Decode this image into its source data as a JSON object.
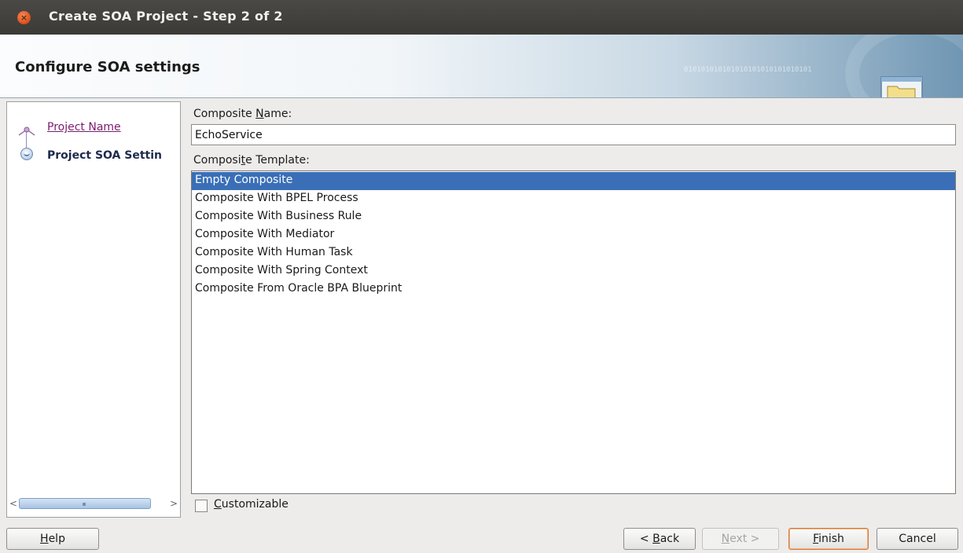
{
  "window": {
    "title": "Create SOA Project - Step 2 of 2",
    "close_glyph": "×"
  },
  "header": {
    "title": "Configure SOA settings",
    "decor_binary": "010101010101010101010101010101",
    "icon": "folder-window-icon"
  },
  "nav": {
    "items": [
      {
        "label": "Project Name",
        "state": "visited"
      },
      {
        "label": "Project SOA Settin",
        "state": "current"
      }
    ],
    "scroll_left": "<",
    "scroll_right": ">"
  },
  "form": {
    "composite_name": {
      "label_before": "Composite ",
      "label_mnemonic": "N",
      "label_after": "ame:",
      "value": "EchoService"
    },
    "composite_template": {
      "label_before": "Composi",
      "label_mnemonic": "t",
      "label_after": "e Template:",
      "selected_index": 0,
      "options": [
        "Empty Composite",
        "Composite With BPEL Process",
        "Composite With Business Rule",
        "Composite With Mediator",
        "Composite With Human Task",
        "Composite With Spring Context",
        "Composite From Oracle BPA Blueprint"
      ]
    },
    "customizable": {
      "label_mnemonic": "C",
      "label_rest": "ustomizable",
      "checked": false
    }
  },
  "buttons": {
    "help": {
      "mnemonic": "H",
      "rest": "elp"
    },
    "back": {
      "prefix": "< ",
      "mnemonic": "B",
      "rest": "ack"
    },
    "next": {
      "mnemonic": "N",
      "rest": "ext >",
      "enabled": false
    },
    "finish": {
      "mnemonic": "F",
      "rest": "inish"
    },
    "cancel": {
      "label": "Cancel"
    }
  },
  "colors": {
    "selection": "#3a6fb7",
    "titlebar": "#3b3a37",
    "visited_link": "#7a1c6e"
  }
}
